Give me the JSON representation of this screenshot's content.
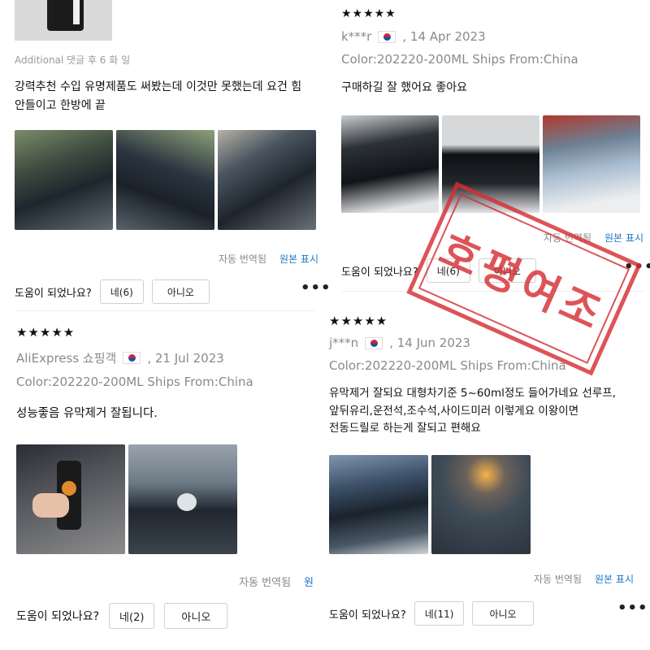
{
  "left": {
    "review1": {
      "additional_note": "Additional 댓글 후 6 화 일",
      "text_line1": "강력추천 수입 유명제품도 써봤는데 이것만 못했는데 요건 힘",
      "text_line2": "안들이고 한방에 끝",
      "translation_auto": "자동 번역됨",
      "translation_original": "원본 표시",
      "helpful_label": "도움이 되었나요?",
      "yes_button": "네(6)",
      "no_button": "아니오"
    },
    "review2": {
      "stars": "★★★★★",
      "author": "AliExpress 쇼핑객",
      "date": ", 21 Jul 2023",
      "variant": "Color:202220-200ML Ships From:China",
      "text": "성능좋음 유막제거 잘됩니다.",
      "translation_auto": "자동 번역됨",
      "translation_original": "원",
      "helpful_label": "도움이 되었나요?",
      "yes_button": "네(2)",
      "no_button": "아니오"
    }
  },
  "right": {
    "review1": {
      "stars": "★★★★★",
      "author": "k***r",
      "date": ", 14 Apr 2023",
      "variant": "Color:202220-200ML Ships From:China",
      "text": "구매하길 잘 했어요 좋아요",
      "translation_auto": "자동 번역됨",
      "translation_original": "원본 표시",
      "helpful_label": "도움이 되었나요?",
      "yes_button": "네(6)",
      "no_button": "아니오"
    },
    "review2": {
      "stars": "★★★★★",
      "author": "j***n",
      "date": ", 14 Jun 2023",
      "variant": "Color:202220-200ML Ships From:China",
      "text_line1": "유막제거 잘되요 대형차기준 5~60ml정도 들어가네요 선루프,",
      "text_line2": "앞뒤유리,운전석,조수석,사이드미러 이렇게요 이왕이면",
      "text_line3": "전동드릴로 하는게 잘되고 편해요",
      "translation_auto": "자동 번역됨",
      "translation_original": "원본 표시",
      "helpful_label": "도움이 되었나요?",
      "yes_button": "네(11)",
      "no_button": "아니오"
    }
  },
  "stamp_text": "호평여조",
  "colors": {
    "accent_link": "#1d77c4",
    "stamp_red": "#d62f34",
    "muted_text": "#8a8a8a"
  },
  "icons": {
    "more": "more-dots-icon",
    "flag": "south-korea-flag-icon"
  }
}
